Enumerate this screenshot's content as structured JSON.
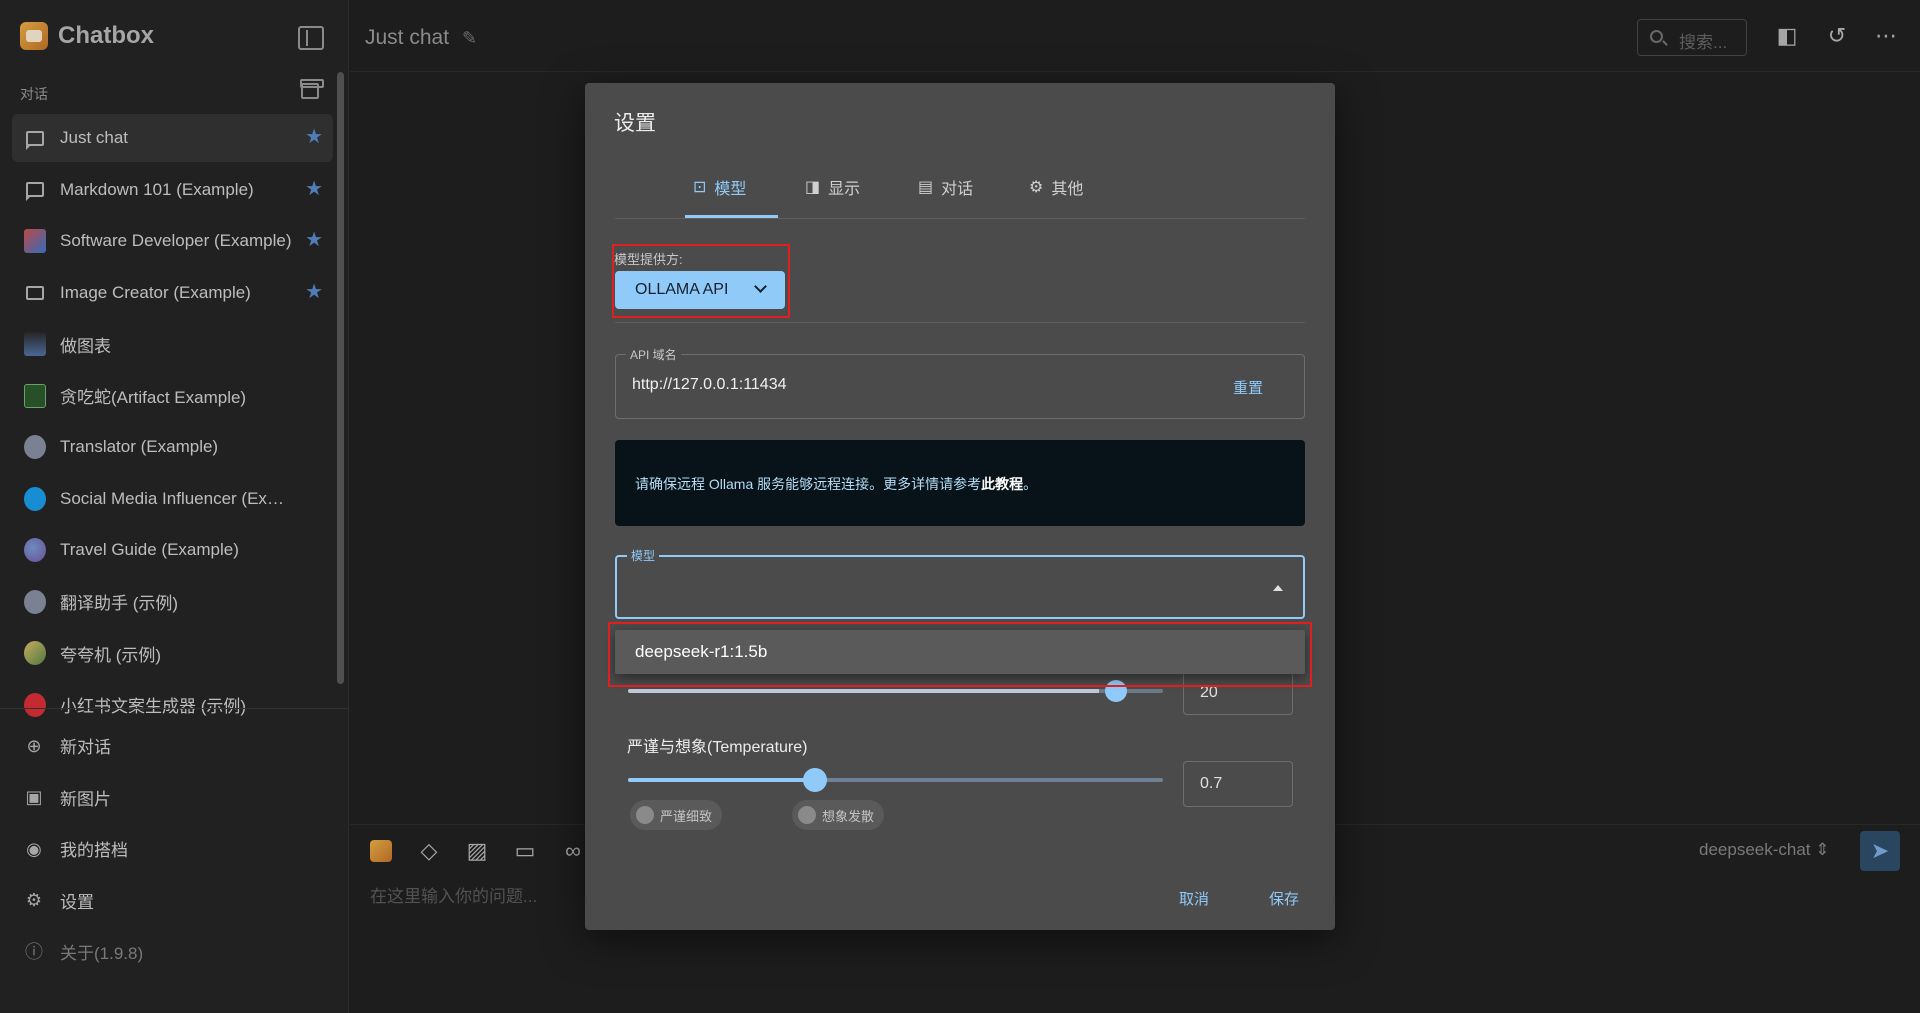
{
  "app": {
    "name": "Chatbox"
  },
  "sidebar": {
    "section_label": "对话",
    "conversations": [
      {
        "label": "Just chat",
        "starred": true
      },
      {
        "label": "Markdown 101 (Example)",
        "starred": true
      },
      {
        "label": "Software Developer (Example)",
        "starred": true
      },
      {
        "label": "Image Creator (Example)",
        "starred": true
      },
      {
        "label": "做图表",
        "starred": false
      },
      {
        "label": "贪吃蛇(Artifact Example)",
        "starred": false
      },
      {
        "label": "Translator (Example)",
        "starred": false
      },
      {
        "label": "Social Media Influencer (Example)",
        "starred": false
      },
      {
        "label": "Travel Guide (Example)",
        "starred": false
      },
      {
        "label": "翻译助手 (示例)",
        "starred": false
      },
      {
        "label": "夸夸机 (示例)",
        "starred": false
      },
      {
        "label": "小红书文案生成器 (示例)",
        "starred": false
      }
    ],
    "menu": {
      "new_chat": "新对话",
      "new_image": "新图片",
      "my_copilots": "我的搭档",
      "settings": "设置",
      "about": "关于(1.9.8)"
    }
  },
  "topbar": {
    "title": "Just chat",
    "search_placeholder": "搜索..."
  },
  "input": {
    "placeholder": "在这里输入你的问题...",
    "model": "deepseek-chat"
  },
  "dialog": {
    "title": "设置",
    "tabs": {
      "model": "模型",
      "display": "显示",
      "chat": "对话",
      "other": "其他"
    },
    "provider_label": "模型提供方:",
    "provider_value": "OLLAMA API",
    "api_host_label": "API 域名",
    "api_host_value": "http://127.0.0.1:11434",
    "reset_label": "重置",
    "notice_text": "请确保远程 Ollama 服务能够远程连接。更多详情请参考",
    "notice_link": "此教程",
    "notice_end": "。",
    "model_label": "模型",
    "model_option": "deepseek-r1:1.5b",
    "max_context_value": "20",
    "max_context_fraction": 0.88,
    "temperature_label": "严谨与想象(Temperature)",
    "temperature_value": "0.7",
    "temperature_fraction": 0.35,
    "chip_strict": "严谨细致",
    "chip_imaginative": "想象发散",
    "cancel_label": "取消",
    "save_label": "保存"
  }
}
